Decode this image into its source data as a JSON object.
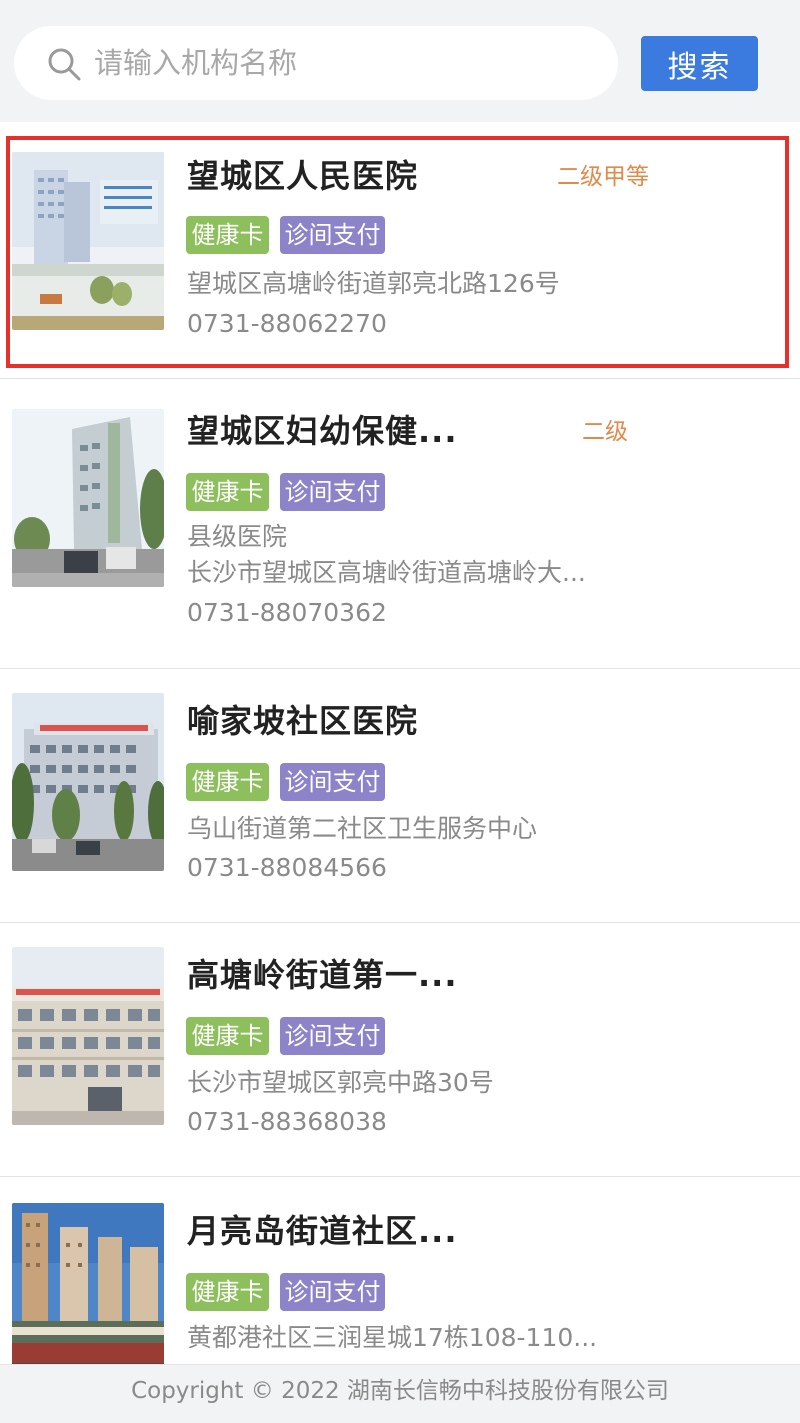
{
  "search": {
    "placeholder": "请输入机构名称",
    "button_label": "搜索"
  },
  "tags": {
    "health_card": "健康卡",
    "payment": "诊间支付"
  },
  "institutions": [
    {
      "name": "望城区人民医院",
      "level": "二级甲等",
      "lines": [
        "望城区高塘岭街道郭亮北路126号",
        "0731-88062270"
      ],
      "selected": true
    },
    {
      "name": "望城区妇幼保健...",
      "level": "二级",
      "lines": [
        "县级医院",
        "长沙市望城区高塘岭街道高塘岭大...",
        "0731-88070362"
      ]
    },
    {
      "name": "喻家坡社区医院",
      "lines": [
        "乌山街道第二社区卫生服务中心",
        "0731-88084566"
      ]
    },
    {
      "name": "高塘岭街道第一...",
      "lines": [
        "长沙市望城区郭亮中路30号",
        "0731-88368038"
      ]
    },
    {
      "name": "月亮岛街道社区...",
      "lines": [
        "黄都港社区三润星城17栋108-110..."
      ]
    }
  ],
  "footer": {
    "copyright": "Copyright © 2022 湖南长信畅中科技股份有限公司"
  },
  "colors": {
    "accent": "#3b7be0",
    "tag_green": "#8dc05c",
    "tag_purple": "#8d83c9",
    "level": "#e08a4c",
    "highlight": "#e8302b"
  }
}
